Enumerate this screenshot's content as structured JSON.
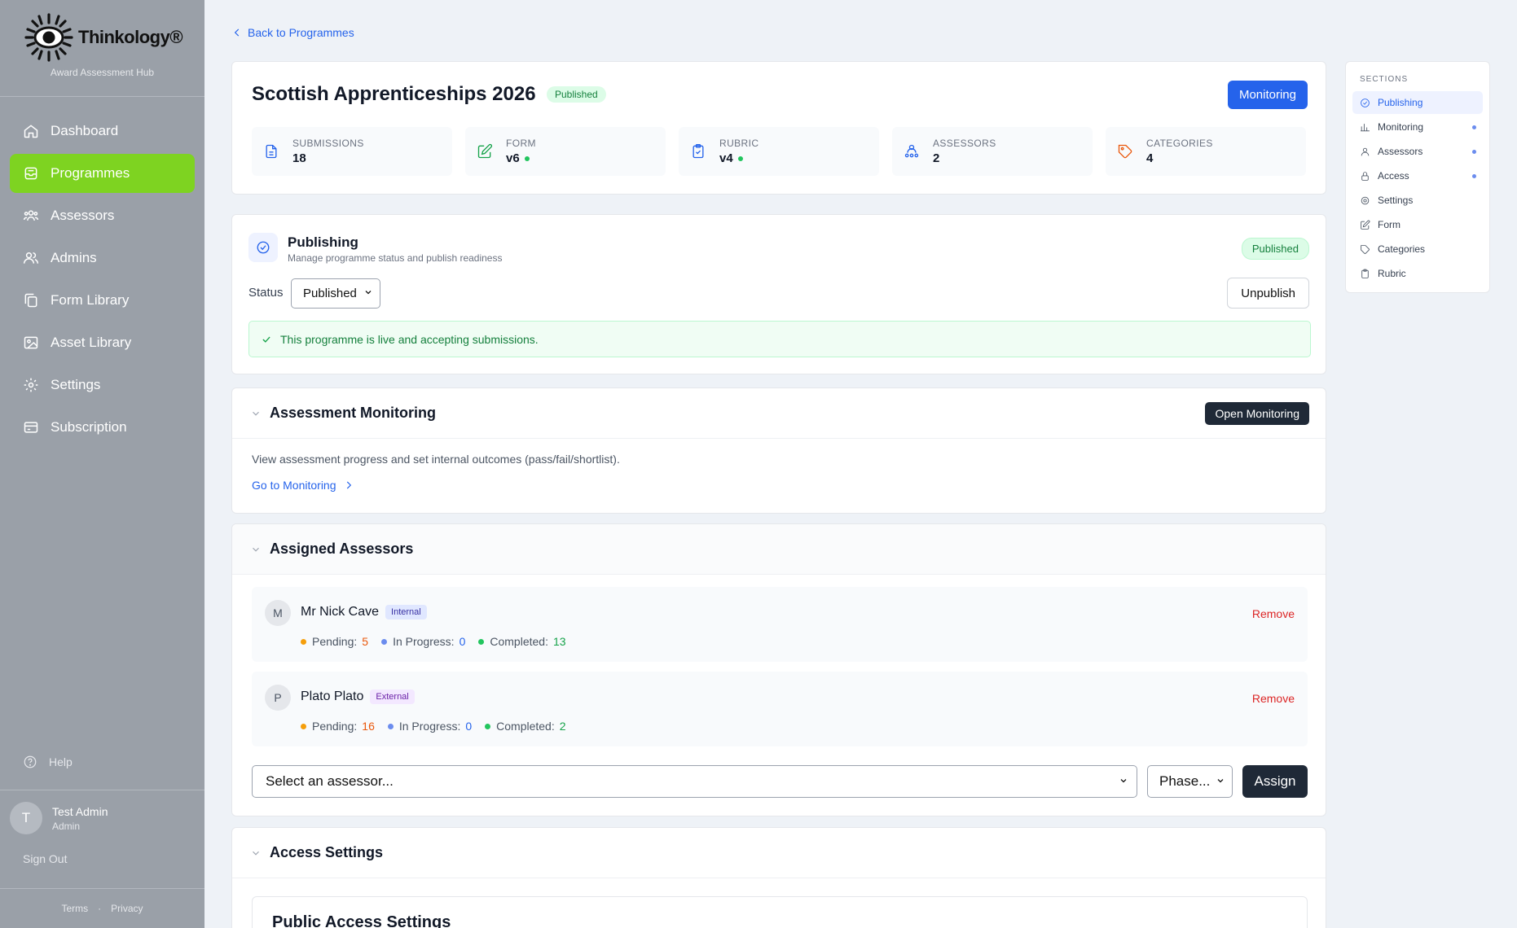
{
  "brand": {
    "name": "Thinkology®",
    "subtitle": "Award Assessment Hub"
  },
  "sidebar": {
    "items": [
      {
        "label": "Dashboard",
        "icon": "home-icon"
      },
      {
        "label": "Programmes",
        "icon": "inbox-icon",
        "active": true
      },
      {
        "label": "Assessors",
        "icon": "users-icon"
      },
      {
        "label": "Admins",
        "icon": "admins-icon"
      },
      {
        "label": "Form Library",
        "icon": "copy-icon"
      },
      {
        "label": "Asset Library",
        "icon": "image-icon"
      },
      {
        "label": "Settings",
        "icon": "gear-icon"
      },
      {
        "label": "Subscription",
        "icon": "card-icon"
      }
    ],
    "help": "Help",
    "user": {
      "initial": "T",
      "name": "Test Admin",
      "role": "Admin"
    },
    "signout": "Sign Out",
    "footer": {
      "terms": "Terms",
      "sep": "·",
      "privacy": "Privacy"
    }
  },
  "back_link": "Back to Programmes",
  "programme": {
    "title": "Scottish Apprenticeships 2026",
    "status_badge": "Published",
    "monitoring_button": "Monitoring",
    "stats": [
      {
        "label": "SUBMISSIONS",
        "value": "18"
      },
      {
        "label": "FORM",
        "value": "v6"
      },
      {
        "label": "RUBRIC",
        "value": "v4"
      },
      {
        "label": "ASSESSORS",
        "value": "2"
      },
      {
        "label": "CATEGORIES",
        "value": "4"
      }
    ]
  },
  "publishing": {
    "title": "Publishing",
    "subtitle": "Manage programme status and publish readiness",
    "badge": "Published",
    "status_label": "Status",
    "status_value": "Published",
    "unpublish_button": "Unpublish",
    "live_message": "This programme is live and accepting submissions."
  },
  "monitoring": {
    "title": "Assessment Monitoring",
    "open_button": "Open Monitoring",
    "description": "View assessment progress and set internal outcomes (pass/fail/shortlist).",
    "link": "Go to Monitoring"
  },
  "assessors": {
    "title": "Assigned Assessors",
    "list": [
      {
        "initial": "M",
        "name": "Mr Nick Cave",
        "tag": "Internal",
        "pending": "5",
        "in_progress": "0",
        "completed": "13"
      },
      {
        "initial": "P",
        "name": "Plato Plato",
        "tag": "External",
        "pending": "16",
        "in_progress": "0",
        "completed": "2"
      }
    ],
    "labels": {
      "pending": "Pending:",
      "in_progress": "In Progress:",
      "completed": "Completed:",
      "remove": "Remove"
    },
    "select_placeholder": "Select an assessor...",
    "phase_placeholder": "Phase...",
    "assign_button": "Assign"
  },
  "access": {
    "title": "Access Settings",
    "public_title": "Public Access Settings"
  },
  "sections_panel": {
    "heading": "SECTIONS",
    "items": [
      {
        "label": "Publishing",
        "active": true,
        "dot": false
      },
      {
        "label": "Monitoring",
        "dot": true
      },
      {
        "label": "Assessors",
        "dot": true
      },
      {
        "label": "Access",
        "dot": true
      },
      {
        "label": "Settings",
        "dot": false
      },
      {
        "label": "Form",
        "dot": false
      },
      {
        "label": "Categories",
        "dot": false
      },
      {
        "label": "Rubric",
        "dot": false
      }
    ]
  },
  "colors": {
    "accent": "#2563eb",
    "nav_active": "#7ed321",
    "sidebar_bg": "#9aa0a8",
    "success": "#16a34a",
    "pending": "#f59e0b",
    "danger": "#dc2626"
  }
}
